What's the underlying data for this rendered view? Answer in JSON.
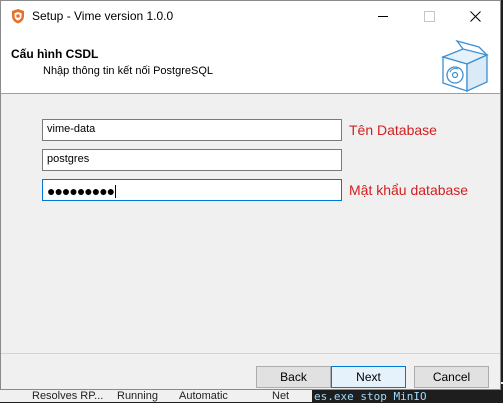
{
  "window": {
    "title": "Setup - Vime version 1.0.0"
  },
  "header": {
    "title": "Cấu hình CSDL",
    "subtitle": "Nhập thông tin kết nối PostgreSQL"
  },
  "form": {
    "database_value": "vime-data",
    "database_hint": "Tên Database",
    "user_value": "postgres",
    "password_masked": "●●●●●●●●●",
    "password_hint": "Mật khẩu database"
  },
  "buttons": {
    "back": "Back",
    "next": "Next",
    "cancel": "Cancel"
  },
  "background": {
    "row_name": "Resolves RP...",
    "row_status": "Running",
    "row_startup": "Automatic",
    "row_logon": "Net",
    "terminal_text": "es.exe stop MinIO"
  },
  "colors": {
    "accent": "#0078d7",
    "hint_red": "#d21f1f"
  }
}
